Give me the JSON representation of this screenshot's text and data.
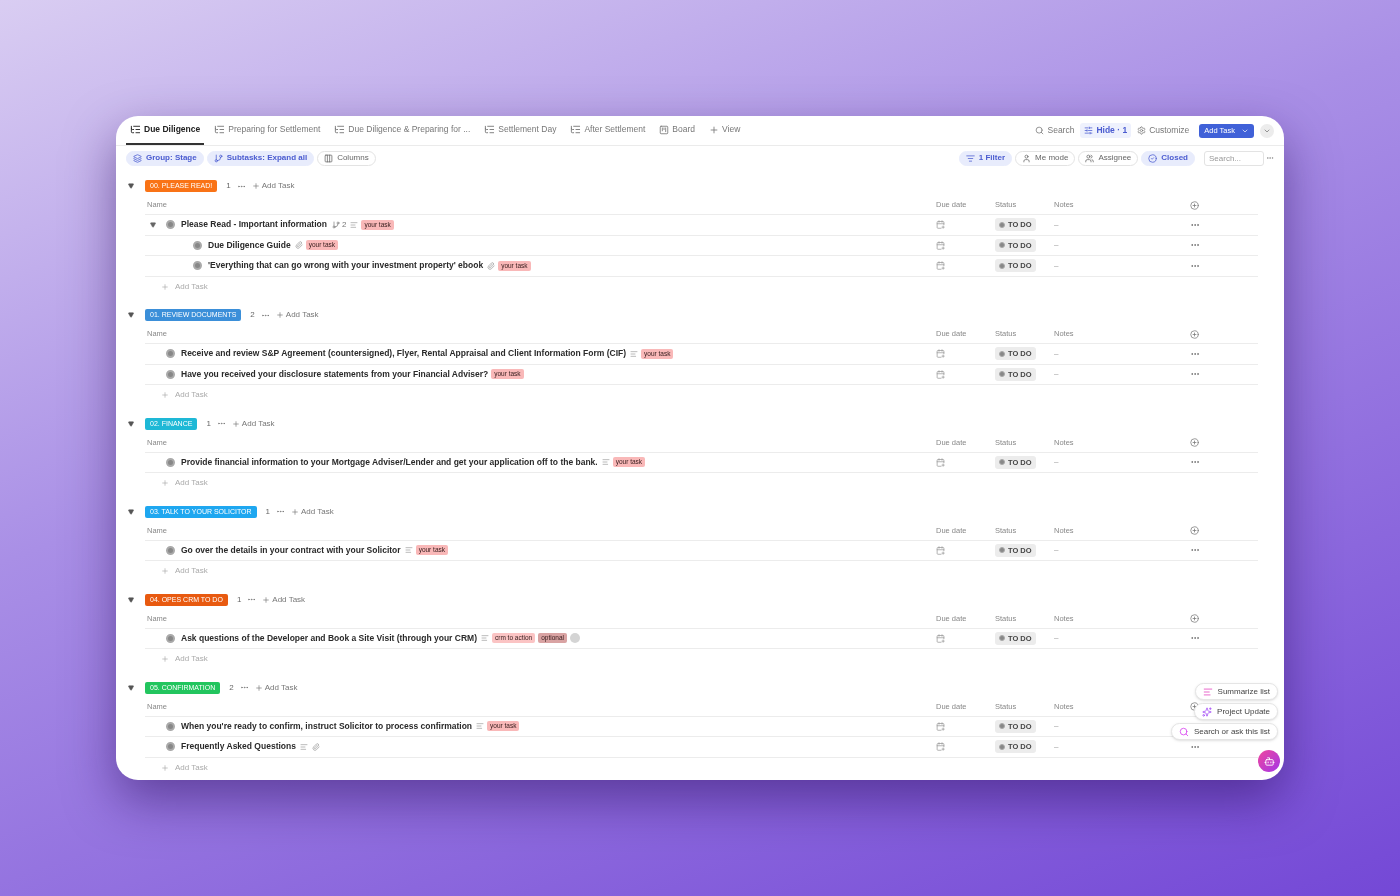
{
  "tabs": [
    {
      "label": "Due Diligence",
      "kind": "list",
      "selected": true
    },
    {
      "label": "Preparing for Settlement",
      "kind": "list",
      "selected": false
    },
    {
      "label": "Due Diligence & Preparing for ...",
      "kind": "list",
      "selected": false
    },
    {
      "label": "Settlement Day",
      "kind": "list",
      "selected": false
    },
    {
      "label": "After Settlement",
      "kind": "list",
      "selected": false
    },
    {
      "label": "Board",
      "kind": "board",
      "selected": false
    },
    {
      "label": "View",
      "kind": "add",
      "selected": false
    }
  ],
  "header_actions": {
    "search": "Search",
    "hide": "Hide · 1",
    "customize": "Customize",
    "add_task": "Add Task"
  },
  "toolbar_left": [
    {
      "label": "Group: Stage",
      "kind": "group",
      "active": true
    },
    {
      "label": "Subtasks: Expand all",
      "kind": "subtasks",
      "active": true
    },
    {
      "label": "Columns",
      "kind": "columns",
      "active": false
    }
  ],
  "toolbar_right": [
    {
      "label": "1 Filter",
      "kind": "filter",
      "active": true
    },
    {
      "label": "Me mode",
      "kind": "me",
      "active": false
    },
    {
      "label": "Assignee",
      "kind": "assignee",
      "active": false
    },
    {
      "label": "Closed",
      "kind": "closed",
      "active": true
    }
  ],
  "search": {
    "placeholder": "Search..."
  },
  "groups": [
    {
      "label": "00. PLEASE READ!",
      "color": "#f97316",
      "count": "1",
      "add_task": "Add Task",
      "expanded": true,
      "columns": [
        "Name",
        "Due date",
        "Status",
        "Notes"
      ],
      "footer": "Add Task",
      "tasks": [
        {
          "name": "Please Read - Important information",
          "subtask_count": "2",
          "description": true,
          "attachment": false,
          "expanded": true,
          "tags": [
            {
              "label": "your task",
              "color": "#f9b8b8"
            }
          ],
          "status": "TO DO",
          "notes": "–",
          "children": [
            {
              "name": "Due Diligence Guide",
              "description": false,
              "attachment": true,
              "tags": [
                {
                  "label": "your task",
                  "color": "#f9b8b8"
                }
              ],
              "status": "TO DO",
              "notes": "–"
            },
            {
              "name": "'Everything that can go wrong with your investment property' ebook",
              "description": false,
              "attachment": true,
              "tags": [
                {
                  "label": "your task",
                  "color": "#f9b8b8"
                }
              ],
              "status": "TO DO",
              "notes": "–"
            }
          ]
        }
      ]
    },
    {
      "label": "01. REVIEW DOCUMENTS",
      "color": "#3b8fd9",
      "count": "2",
      "add_task": "Add Task",
      "expanded": true,
      "columns": [
        "Name",
        "Due date",
        "Status",
        "Notes"
      ],
      "footer": "Add Task",
      "tasks": [
        {
          "name": "Receive and review S&P Agreement (countersigned), Flyer, Rental Appraisal and Client Information Form (CIF)",
          "description": true,
          "attachment": false,
          "tags": [
            {
              "label": "your task",
              "color": "#f9b8b8"
            }
          ],
          "status": "TO DO",
          "notes": "–"
        },
        {
          "name": "Have you received your disclosure statements from your Financial Adviser?",
          "description": false,
          "attachment": false,
          "tags": [
            {
              "label": "your task",
              "color": "#f9b8b8"
            }
          ],
          "status": "TO DO",
          "notes": "–"
        }
      ]
    },
    {
      "label": "02. FINANCE",
      "color": "#1eb8d6",
      "count": "1",
      "add_task": "Add Task",
      "expanded": true,
      "columns": [
        "Name",
        "Due date",
        "Status",
        "Notes"
      ],
      "footer": "Add Task",
      "tasks": [
        {
          "name": "Provide financial information to your Mortgage Adviser/Lender and get your application off to the bank.",
          "description": true,
          "attachment": false,
          "tags": [
            {
              "label": "your task",
              "color": "#f9b8b8"
            }
          ],
          "status": "TO DO",
          "notes": "–"
        }
      ]
    },
    {
      "label": "03. TALK TO YOUR SOLICITOR",
      "color": "#1ea7f0",
      "count": "1",
      "add_task": "Add Task",
      "expanded": true,
      "columns": [
        "Name",
        "Due date",
        "Status",
        "Notes"
      ],
      "footer": "Add Task",
      "tasks": [
        {
          "name": "Go over the details in your contract with your Solicitor",
          "description": true,
          "attachment": false,
          "tags": [
            {
              "label": "your task",
              "color": "#f9b8b8"
            }
          ],
          "status": "TO DO",
          "notes": "–"
        }
      ]
    },
    {
      "label": "04. OPES CRM TO DO",
      "color": "#e85a10",
      "count": "1",
      "add_task": "Add Task",
      "expanded": true,
      "columns": [
        "Name",
        "Due date",
        "Status",
        "Notes"
      ],
      "footer": "Add Task",
      "tasks": [
        {
          "name": "Ask questions of the Developer and Book a Site Visit (through your CRM)",
          "description": true,
          "attachment": false,
          "more_tags": true,
          "tags": [
            {
              "label": "crm to action",
              "color": "#fbc4c4"
            },
            {
              "label": "optional",
              "color": "#d9a3a3"
            }
          ],
          "status": "TO DO",
          "notes": "–"
        }
      ]
    },
    {
      "label": "05. CONFIRMATION",
      "color": "#22c55e",
      "count": "2",
      "add_task": "Add Task",
      "expanded": true,
      "columns": [
        "Name",
        "Due date",
        "Status",
        "Notes"
      ],
      "footer": "Add Task",
      "tasks": [
        {
          "name": "When you're ready to confirm, instruct Solicitor to process confirmation",
          "description": true,
          "attachment": false,
          "tags": [
            {
              "label": "your task",
              "color": "#f9b8b8"
            }
          ],
          "status": "TO DO",
          "notes": "–"
        },
        {
          "name": "Frequently Asked Questions",
          "description": true,
          "attachment": true,
          "status": "TO DO",
          "notes": "–"
        }
      ]
    }
  ],
  "ai_actions": [
    {
      "label": "Summarize list",
      "kind": "summarize"
    },
    {
      "label": "Project Update",
      "kind": "update"
    },
    {
      "label": "Search or ask this list",
      "kind": "search"
    }
  ]
}
